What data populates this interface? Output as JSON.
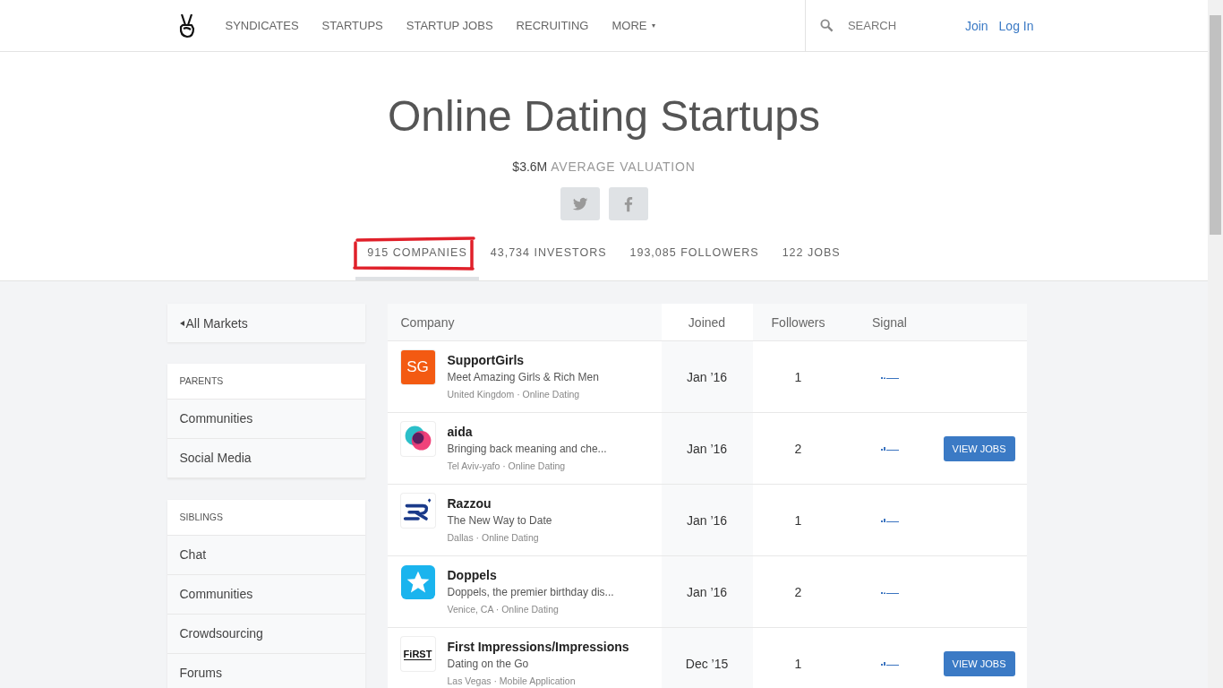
{
  "nav": {
    "items": [
      {
        "label": "SYNDICATES"
      },
      {
        "label": "STARTUPS"
      },
      {
        "label": "STARTUP JOBS"
      },
      {
        "label": "RECRUITING"
      },
      {
        "label": "MORE",
        "caret": "▾"
      }
    ],
    "search": {
      "placeholder": "SEARCH"
    },
    "links": [
      "Join",
      "Log In"
    ]
  },
  "hero": {
    "title": "Online Dating Startups",
    "valuation": "$3.6M",
    "valuation_label": "AVERAGE VALUATION"
  },
  "stats": [
    {
      "label": "915 COMPANIES",
      "selected": true,
      "circled": true
    },
    {
      "label": "43,734 INVESTORS",
      "selected": false,
      "circled": false
    },
    {
      "label": "193,085 FOLLOWERS",
      "selected": false,
      "circled": false
    },
    {
      "label": "122 JOBS",
      "selected": false,
      "circled": false
    }
  ],
  "sidebar": {
    "back": "All Markets",
    "sections": [
      {
        "heading": "PARENTS",
        "items": [
          "Communities",
          "Social Media"
        ]
      },
      {
        "heading": "SIBLINGS",
        "items": [
          "Chat",
          "Communities",
          "Crowdsourcing",
          "Forums"
        ]
      }
    ]
  },
  "table": {
    "columns": [
      "Company",
      "Joined",
      "Followers",
      "Signal"
    ],
    "rows": [
      {
        "kind": "sg",
        "logo_text": "SG",
        "name": "SupportGirls",
        "pitch": "Meet Amazing Girls & Rich Men",
        "meta": "United Kingdom · Online Dating",
        "joined": "Jan ’16",
        "followers": "1",
        "button": null
      },
      {
        "kind": "circles",
        "name": "aida",
        "pitch": "Bringing back meaning and che...",
        "meta": "Tel Aviv-yafo · Online Dating",
        "joined": "Jan ’16",
        "followers": "2",
        "button": "VIEW JOBS"
      },
      {
        "kind": "r",
        "name": "Razzou",
        "pitch": "The New Way to Date",
        "meta": "Dallas · Online Dating",
        "joined": "Jan ’16",
        "followers": "1",
        "button": null
      },
      {
        "kind": "star",
        "name": "Doppels",
        "pitch": "Doppels, the premier birthday dis...",
        "meta": "Venice, CA · Online Dating",
        "joined": "Jan ’16",
        "followers": "2",
        "button": null
      },
      {
        "kind": "first",
        "logo_text": "FiRST",
        "name": "First Impressions/Impressions",
        "pitch": "Dating on the Go",
        "meta": "Las Vegas · Mobile Application",
        "joined": "Dec ’15",
        "followers": "1",
        "button": "VIEW JOBS"
      }
    ]
  }
}
